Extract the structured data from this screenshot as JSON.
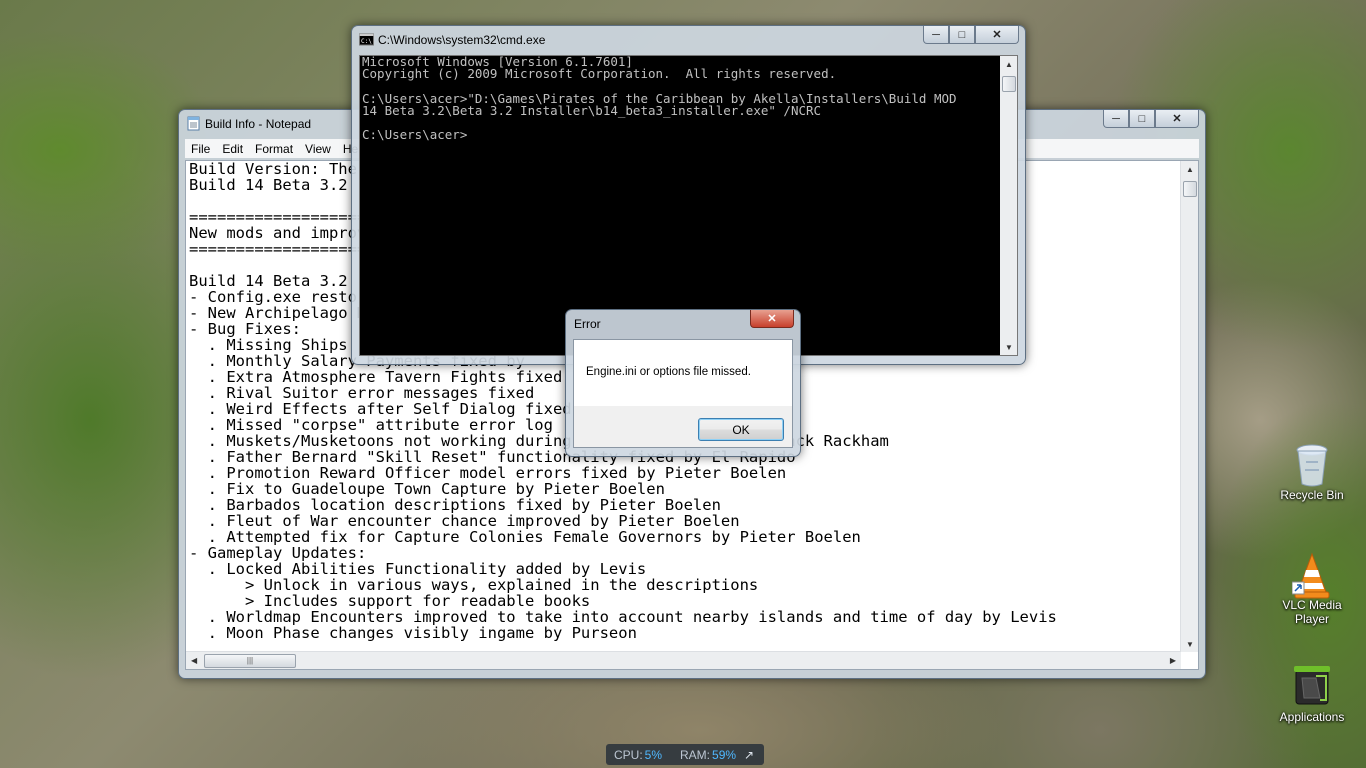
{
  "notepad": {
    "title": "Build Info - Notepad",
    "menu": [
      "File",
      "Edit",
      "Format",
      "View",
      "Help"
    ],
    "lines": [
      "Build Version: The Pirates of the Caribbean New Horizons",
      "Build 14 Beta 3.2",
      "",
      "==============================================================",
      "New mods and improvements",
      "==============================================================",
      "",
      "Build 14 Beta 3.2",
      "- Config.exe restored",
      "- New Archipelago Map",
      "- Bug Fixes:",
      "  . Missing Ships",
      "  . Monthly Salary Payments fixed by",
      "  . Extra Atmosphere Tavern Fights fixed",
      "  . Rival Suitor error messages fixed",
      "  . Weird Effects after Self Dialog fixed",
      "  . Missed \"corpse\" attribute error log",
      "  . Muskets/Musketoons not working during                      Jack Rackham",
      "  . Father Bernard \"Skill Reset\" functionality fixed by El Rapido",
      "  . Promotion Reward Officer model errors fixed by Pieter Boelen",
      "  . Fix to Guadeloupe Town Capture by Pieter Boelen",
      "  . Barbados location descriptions fixed by Pieter Boelen",
      "  . Fleut of War encounter chance improved by Pieter Boelen",
      "  . Attempted fix for Capture Colonies Female Governors by Pieter Boelen",
      "- Gameplay Updates:",
      "  . Locked Abilities Functionality added by Levis",
      "      > Unlock in various ways, explained in the descriptions",
      "      > Includes support for readable books",
      "  . Worldmap Encounters improved to take into account nearby islands and time of day by Levis",
      "  . Moon Phase changes visibly ingame by Purseon"
    ]
  },
  "cmd": {
    "title": "C:\\Windows\\system32\\cmd.exe",
    "lines": [
      "Microsoft Windows [Version 6.1.7601]",
      "Copyright (c) 2009 Microsoft Corporation.  All rights reserved.",
      "",
      "C:\\Users\\acer>\"D:\\Games\\Pirates of the Caribbean by Akella\\Installers\\Build MOD",
      "14 Beta 3.2\\Beta 3.2 Installer\\b14_beta3_installer.exe\" /NCRC",
      "",
      "C:\\Users\\acer>"
    ]
  },
  "error_dialog": {
    "title": "Error",
    "message": "Engine.ini or options file missed.",
    "ok_label": "OK"
  },
  "desktop_icons": [
    {
      "label": "Recycle Bin",
      "icon": "recycle-bin-icon"
    },
    {
      "label": "VLC Media Player",
      "icon": "vlc-cone-icon"
    },
    {
      "label": "Applications",
      "icon": "applications-icon"
    }
  ],
  "gadget": {
    "cpu_label": "CPU:",
    "cpu_value": "5%",
    "ram_label": "RAM:",
    "ram_value": "59%"
  }
}
